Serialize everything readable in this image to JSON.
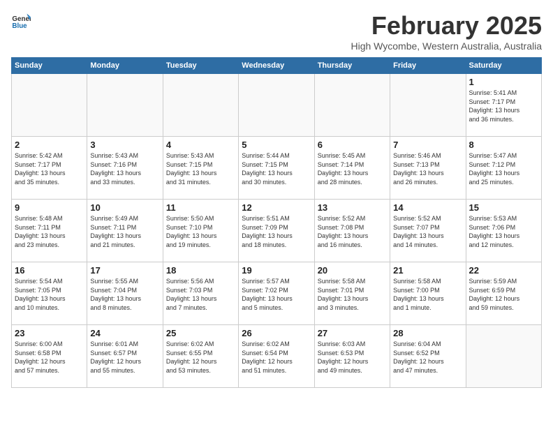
{
  "logo": {
    "general": "General",
    "blue": "Blue"
  },
  "title": "February 2025",
  "subtitle": "High Wycombe, Western Australia, Australia",
  "days_of_week": [
    "Sunday",
    "Monday",
    "Tuesday",
    "Wednesday",
    "Thursday",
    "Friday",
    "Saturday"
  ],
  "weeks": [
    [
      {
        "day": "",
        "info": ""
      },
      {
        "day": "",
        "info": ""
      },
      {
        "day": "",
        "info": ""
      },
      {
        "day": "",
        "info": ""
      },
      {
        "day": "",
        "info": ""
      },
      {
        "day": "",
        "info": ""
      },
      {
        "day": "1",
        "info": "Sunrise: 5:41 AM\nSunset: 7:17 PM\nDaylight: 13 hours\nand 36 minutes."
      }
    ],
    [
      {
        "day": "2",
        "info": "Sunrise: 5:42 AM\nSunset: 7:17 PM\nDaylight: 13 hours\nand 35 minutes."
      },
      {
        "day": "3",
        "info": "Sunrise: 5:43 AM\nSunset: 7:16 PM\nDaylight: 13 hours\nand 33 minutes."
      },
      {
        "day": "4",
        "info": "Sunrise: 5:43 AM\nSunset: 7:15 PM\nDaylight: 13 hours\nand 31 minutes."
      },
      {
        "day": "5",
        "info": "Sunrise: 5:44 AM\nSunset: 7:15 PM\nDaylight: 13 hours\nand 30 minutes."
      },
      {
        "day": "6",
        "info": "Sunrise: 5:45 AM\nSunset: 7:14 PM\nDaylight: 13 hours\nand 28 minutes."
      },
      {
        "day": "7",
        "info": "Sunrise: 5:46 AM\nSunset: 7:13 PM\nDaylight: 13 hours\nand 26 minutes."
      },
      {
        "day": "8",
        "info": "Sunrise: 5:47 AM\nSunset: 7:12 PM\nDaylight: 13 hours\nand 25 minutes."
      }
    ],
    [
      {
        "day": "9",
        "info": "Sunrise: 5:48 AM\nSunset: 7:11 PM\nDaylight: 13 hours\nand 23 minutes."
      },
      {
        "day": "10",
        "info": "Sunrise: 5:49 AM\nSunset: 7:11 PM\nDaylight: 13 hours\nand 21 minutes."
      },
      {
        "day": "11",
        "info": "Sunrise: 5:50 AM\nSunset: 7:10 PM\nDaylight: 13 hours\nand 19 minutes."
      },
      {
        "day": "12",
        "info": "Sunrise: 5:51 AM\nSunset: 7:09 PM\nDaylight: 13 hours\nand 18 minutes."
      },
      {
        "day": "13",
        "info": "Sunrise: 5:52 AM\nSunset: 7:08 PM\nDaylight: 13 hours\nand 16 minutes."
      },
      {
        "day": "14",
        "info": "Sunrise: 5:52 AM\nSunset: 7:07 PM\nDaylight: 13 hours\nand 14 minutes."
      },
      {
        "day": "15",
        "info": "Sunrise: 5:53 AM\nSunset: 7:06 PM\nDaylight: 13 hours\nand 12 minutes."
      }
    ],
    [
      {
        "day": "16",
        "info": "Sunrise: 5:54 AM\nSunset: 7:05 PM\nDaylight: 13 hours\nand 10 minutes."
      },
      {
        "day": "17",
        "info": "Sunrise: 5:55 AM\nSunset: 7:04 PM\nDaylight: 13 hours\nand 8 minutes."
      },
      {
        "day": "18",
        "info": "Sunrise: 5:56 AM\nSunset: 7:03 PM\nDaylight: 13 hours\nand 7 minutes."
      },
      {
        "day": "19",
        "info": "Sunrise: 5:57 AM\nSunset: 7:02 PM\nDaylight: 13 hours\nand 5 minutes."
      },
      {
        "day": "20",
        "info": "Sunrise: 5:58 AM\nSunset: 7:01 PM\nDaylight: 13 hours\nand 3 minutes."
      },
      {
        "day": "21",
        "info": "Sunrise: 5:58 AM\nSunset: 7:00 PM\nDaylight: 13 hours\nand 1 minute."
      },
      {
        "day": "22",
        "info": "Sunrise: 5:59 AM\nSunset: 6:59 PM\nDaylight: 12 hours\nand 59 minutes."
      }
    ],
    [
      {
        "day": "23",
        "info": "Sunrise: 6:00 AM\nSunset: 6:58 PM\nDaylight: 12 hours\nand 57 minutes."
      },
      {
        "day": "24",
        "info": "Sunrise: 6:01 AM\nSunset: 6:57 PM\nDaylight: 12 hours\nand 55 minutes."
      },
      {
        "day": "25",
        "info": "Sunrise: 6:02 AM\nSunset: 6:55 PM\nDaylight: 12 hours\nand 53 minutes."
      },
      {
        "day": "26",
        "info": "Sunrise: 6:02 AM\nSunset: 6:54 PM\nDaylight: 12 hours\nand 51 minutes."
      },
      {
        "day": "27",
        "info": "Sunrise: 6:03 AM\nSunset: 6:53 PM\nDaylight: 12 hours\nand 49 minutes."
      },
      {
        "day": "28",
        "info": "Sunrise: 6:04 AM\nSunset: 6:52 PM\nDaylight: 12 hours\nand 47 minutes."
      },
      {
        "day": "",
        "info": ""
      }
    ]
  ]
}
